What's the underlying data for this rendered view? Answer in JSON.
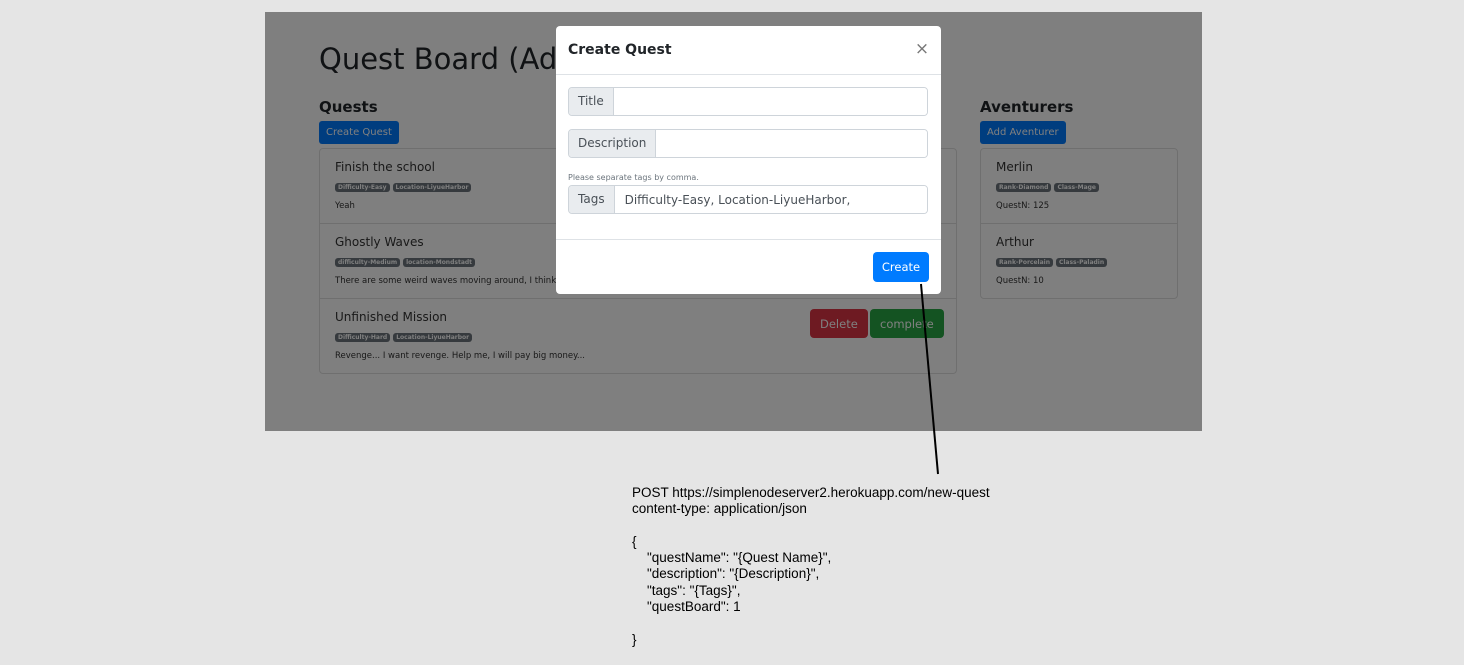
{
  "app": {
    "title": "Quest Board (Admin)",
    "quests": {
      "heading": "Quests",
      "create_button": "Create Quest",
      "items": [
        {
          "title": "Finish the school",
          "badges": [
            "Difficulty-Easy",
            "Location-LiyueHarbor"
          ],
          "description": "Yeah"
        },
        {
          "title": "Ghostly Waves",
          "badges": [
            "difficulty-Medium",
            "location-Mondstadt"
          ],
          "description": "There are some weird waves moving around, I think it might be a ghost..."
        },
        {
          "title": "Unfinished Mission",
          "badges": [
            "Difficulty-Hard",
            "Location-LiyueHarbor"
          ],
          "description": "Revenge... I want revenge. Help me, I will pay big money...",
          "delete_button": "Delete",
          "complete_button": "complete"
        }
      ]
    },
    "adventurers": {
      "heading": "Aventurers",
      "add_button": "Add Aventurer",
      "items": [
        {
          "name": "Merlin",
          "badges": [
            "Rank-Diamond",
            "Class-Mage"
          ],
          "quest_count": "QuestN: 125"
        },
        {
          "name": "Arthur",
          "badges": [
            "Rank-Porcelain",
            "Class-Paladin"
          ],
          "quest_count": "QuestN: 10"
        }
      ]
    }
  },
  "modal": {
    "title": "Create Quest",
    "close_glyph": "×",
    "title_label": "Title",
    "title_value": "",
    "description_label": "Description",
    "description_value": "",
    "tags_help": "Please separate tags by comma.",
    "tags_label": "Tags",
    "tags_value": "Difficulty-Easy, Location-LiyueHarbor,",
    "create_button": "Create"
  },
  "annotation": {
    "lines": [
      "POST https://simplenodeserver2.herokuapp.com/new-quest",
      "content-type: application/json",
      "",
      "{",
      "    \"questName\": \"{Quest Name}\",",
      "    \"description\": \"{Description}\",",
      "    \"tags\": \"{Tags}\",",
      "    \"questBoard\": 1",
      "",
      "}"
    ]
  },
  "colors": {
    "primary": "#007bff",
    "danger": "#dc3545",
    "success": "#28a745",
    "badge": "#6c757d"
  }
}
